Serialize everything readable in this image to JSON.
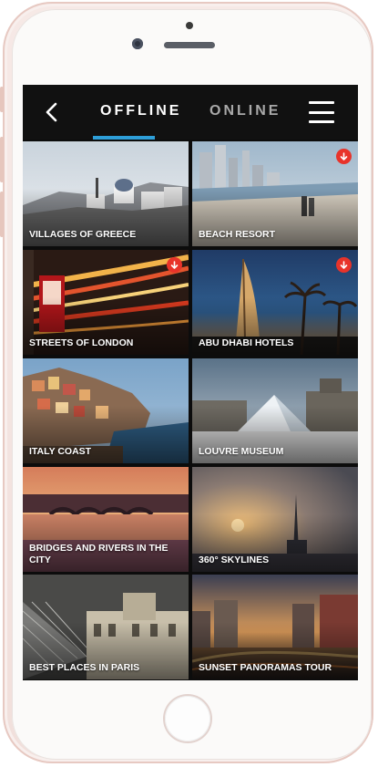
{
  "header": {
    "tabs": [
      {
        "label": "OFFLINE",
        "active": true
      },
      {
        "label": "ONLINE",
        "active": false
      }
    ],
    "accent_color": "#2e9fd9"
  },
  "download_badge_color": "#e8332a",
  "tiles": [
    {
      "label": "VILLAGES OF GREECE",
      "downloadable": false
    },
    {
      "label": "BEACH RESORT",
      "downloadable": true
    },
    {
      "label": "STREETS OF LONDON",
      "downloadable": true
    },
    {
      "label": "ABU DHABI HOTELS",
      "downloadable": true
    },
    {
      "label": "ITALY COAST",
      "downloadable": false
    },
    {
      "label": "LOUVRE MUSEUM",
      "downloadable": false
    },
    {
      "label": "BRIDGES AND RIVERS IN THE CITY",
      "downloadable": false
    },
    {
      "label": "360° SKYLINES",
      "downloadable": false
    },
    {
      "label": "BEST PLACES IN PARIS",
      "downloadable": false
    },
    {
      "label": "SUNSET PANORAMAS TOUR",
      "downloadable": false
    }
  ]
}
